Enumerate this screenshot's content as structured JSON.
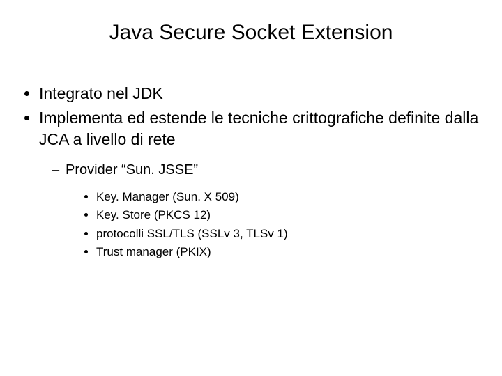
{
  "title": "Java Secure Socket Extension",
  "bullets": {
    "b1": "Integrato nel JDK",
    "b2": "Implementa ed estende le tecniche crittografiche definite dalla JCA a livello di rete",
    "sub1": "Provider “Sun. JSSE”",
    "ssub1": "Key. Manager (Sun. X 509)",
    "ssub2": "Key. Store (PKCS 12)",
    "ssub3": "protocolli SSL/TLS (SSLv 3, TLSv 1)",
    "ssub4": "Trust manager (PKIX)"
  }
}
